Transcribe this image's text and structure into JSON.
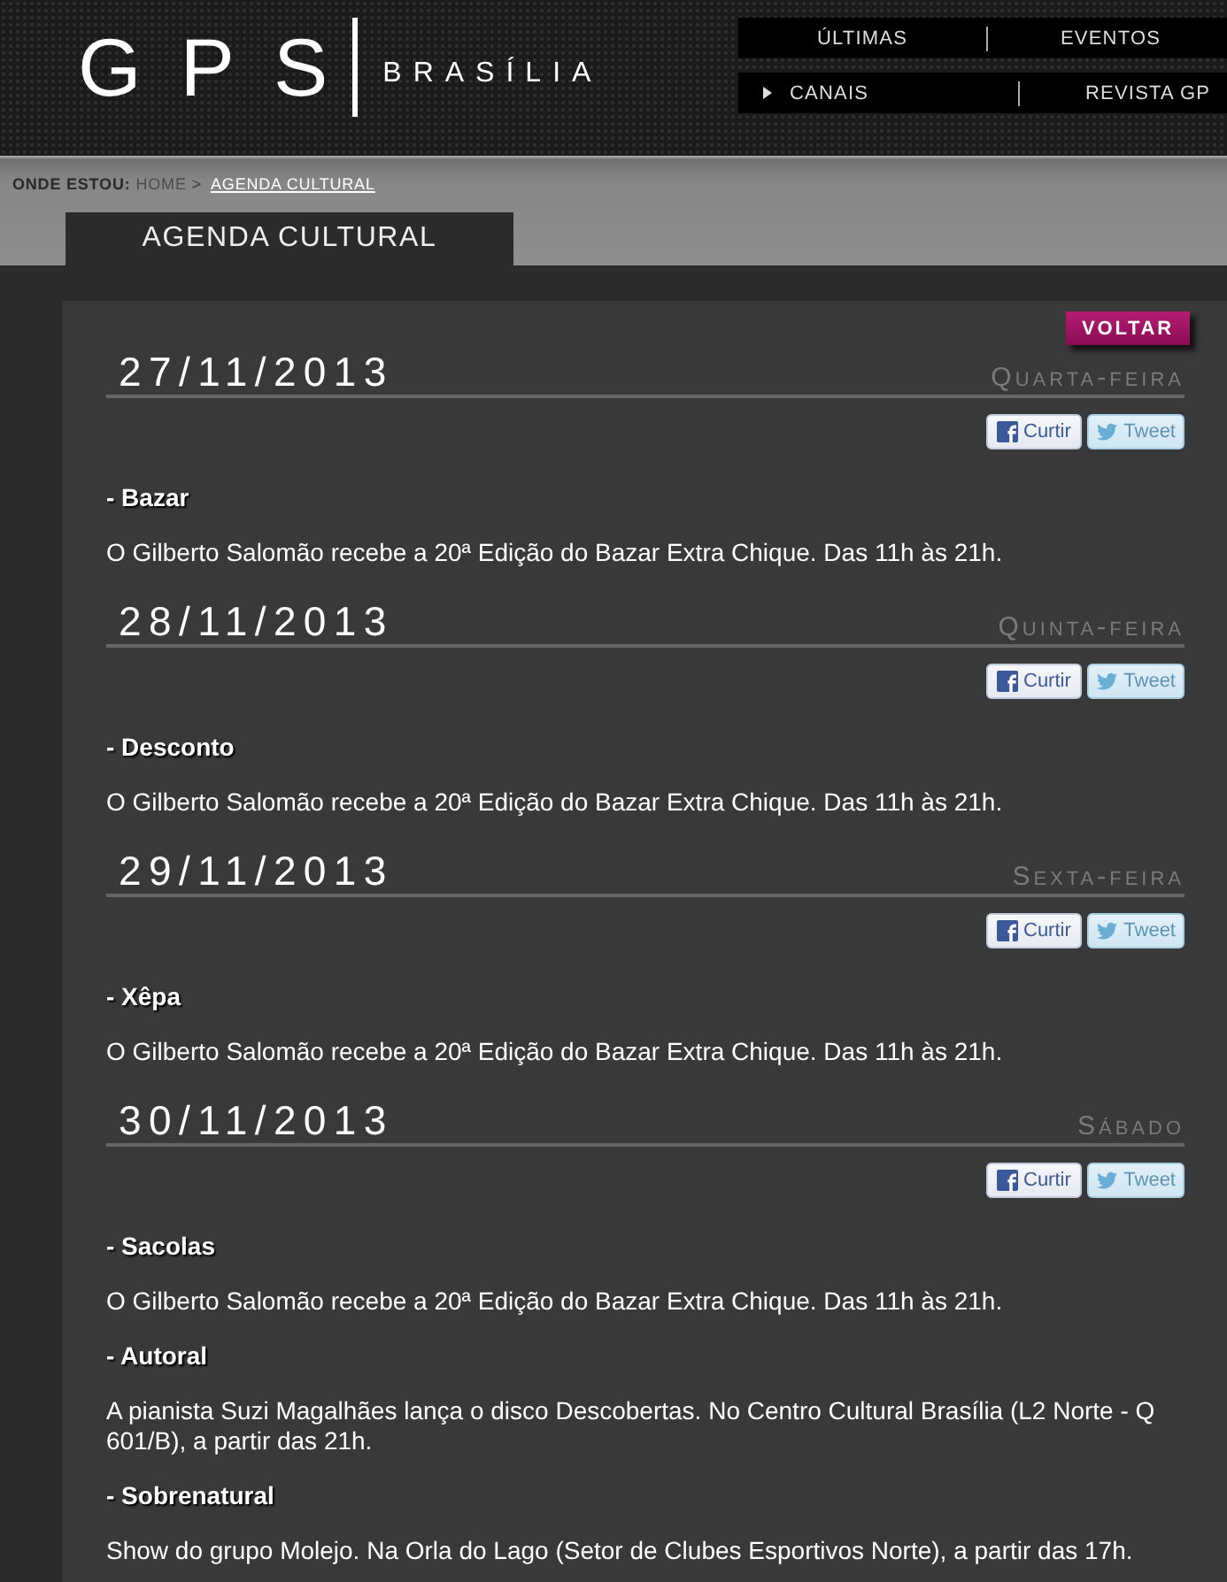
{
  "header": {
    "logo": {
      "name": "GPS",
      "city": "BRASÍLIA"
    },
    "nav_rows": [
      [
        {
          "label": "ÚLTIMAS",
          "kind": "link"
        },
        {
          "label": "EVENTOS",
          "kind": "link"
        }
      ],
      [
        {
          "label": "CANAIS",
          "kind": "menu"
        },
        {
          "label": "REVISTA GP",
          "kind": "link"
        }
      ]
    ]
  },
  "breadcrumb": {
    "prefix": "ONDE ESTOU:",
    "separator": ">",
    "items": [
      {
        "label": "HOME",
        "current": false
      },
      {
        "label": "AGENDA CULTURAL",
        "current": true
      }
    ]
  },
  "section_tab": "AGENDA CULTURAL",
  "back_button": "VOLTAR",
  "days": [
    {
      "date": "27/11/2013",
      "weekday": "Quarta-feira",
      "share": {
        "like": "Curtir",
        "tweet": "Tweet"
      },
      "events": [
        {
          "title": "- Bazar",
          "description": "O Gilberto Salomão recebe a 20ª Edição do Bazar Extra Chique. Das 11h às 21h."
        }
      ]
    },
    {
      "date": "28/11/2013",
      "weekday": "Quinta-feira",
      "share": {
        "like": "Curtir",
        "tweet": "Tweet"
      },
      "events": [
        {
          "title": "- Desconto",
          "description": "O Gilberto Salomão recebe a 20ª Edição do Bazar Extra Chique. Das 11h às 21h."
        }
      ]
    },
    {
      "date": "29/11/2013",
      "weekday": "Sexta-feira",
      "share": {
        "like": "Curtir",
        "tweet": "Tweet"
      },
      "events": [
        {
          "title": "- Xêpa",
          "description": "O Gilberto Salomão recebe a 20ª Edição do Bazar Extra Chique. Das 11h às 21h."
        }
      ]
    },
    {
      "date": "30/11/2013",
      "weekday": "Sábado",
      "share": {
        "like": "Curtir",
        "tweet": "Tweet"
      },
      "events": [
        {
          "title": "- Sacolas",
          "description": "O Gilberto Salomão recebe a 20ª Edição do Bazar Extra Chique. Das 11h às 21h."
        },
        {
          "title": "- Autoral",
          "description": "A pianista Suzi Magalhães lança o disco Descobertas. No Centro Cultural Brasília (L2 Norte - Q 601/B), a partir das 21h."
        },
        {
          "title": "- Sobrenatural",
          "description": "Show do grupo Molejo. Na Orla do Lago (Setor de Clubes Esportivos Norte), a partir das 17h."
        }
      ]
    }
  ]
}
